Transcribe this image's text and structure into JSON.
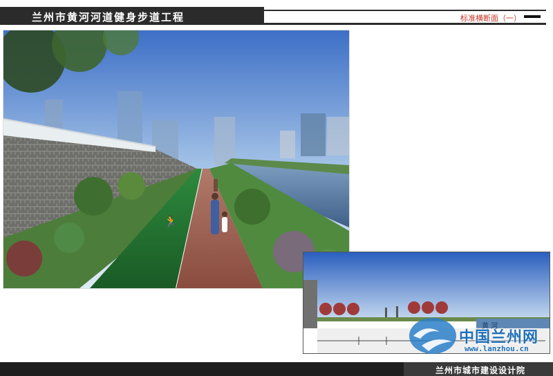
{
  "header": {
    "title": "兰州市黄河河道健身步道工程",
    "subtitle": "标准横断面（一）"
  },
  "section": {
    "river_label": "黄  河"
  },
  "watermark": {
    "name": "中国兰州网",
    "url": "www.lanzhou.cn"
  },
  "footer": {
    "institute": "兰州市城市建设设计院"
  },
  "colors": {
    "header_bg": "#2b2b2b",
    "subtitle_red": "#c0392b",
    "track_green": "#1f6a2f",
    "walkway_brick": "#9a5a4a",
    "river": "#4d6f9a",
    "watermark_blue": "#1f6fb8"
  }
}
